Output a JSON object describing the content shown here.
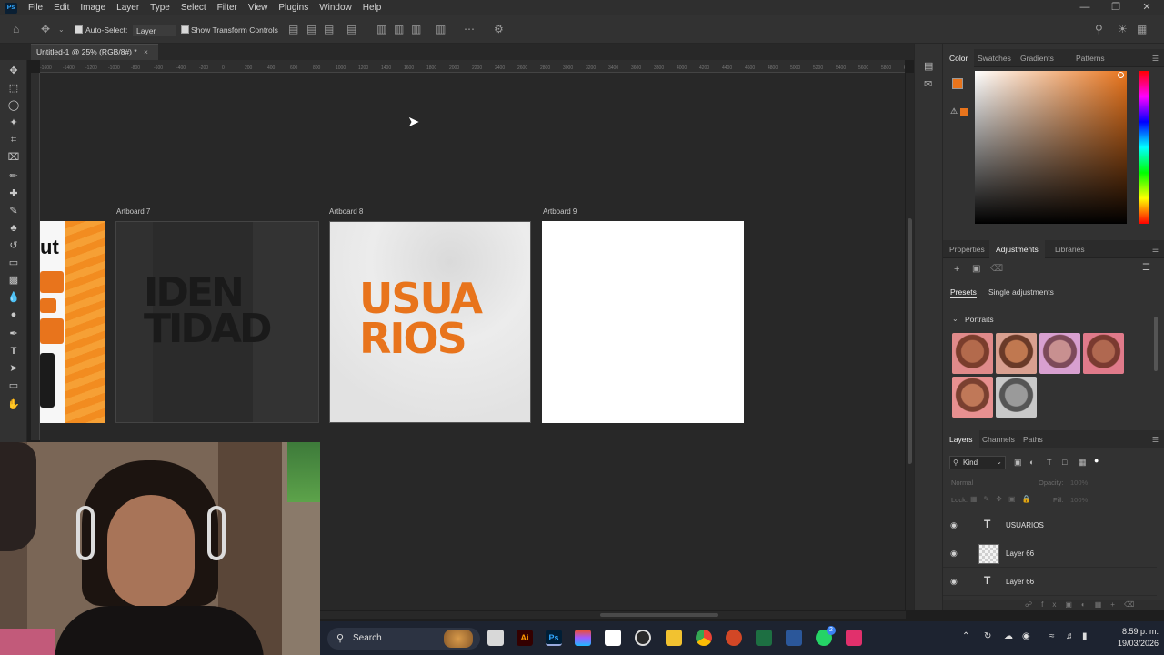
{
  "app": {
    "menu": [
      "File",
      "Edit",
      "Image",
      "Layer",
      "Type",
      "Select",
      "Filter",
      "View",
      "Plugins",
      "Window",
      "Help"
    ],
    "logo_text": "Ps"
  },
  "options_bar": {
    "auto_select_label": "Auto-Select:",
    "auto_select_value": "Layer",
    "show_transform_label": "Show Transform Controls"
  },
  "document": {
    "tab_title": "Untitled-1 @ 25% (RGB/8#) *",
    "ruler_ticks": [
      "-1600",
      "-1400",
      "-1200",
      "-1000",
      "-800",
      "-600",
      "-400",
      "-200",
      "0",
      "200",
      "400",
      "600",
      "800",
      "1000",
      "1200",
      "1400",
      "1600",
      "1800",
      "2000",
      "2200",
      "2400",
      "2600",
      "2800",
      "3000",
      "3200",
      "3400",
      "3600",
      "3800",
      "4000",
      "4200",
      "4400",
      "4600",
      "4800",
      "5000",
      "5200",
      "5400",
      "5600",
      "5800",
      "6000"
    ]
  },
  "artboards": [
    {
      "label": "",
      "partial_text": "ut"
    },
    {
      "label": "Artboard 7",
      "text_line1": "IDEN",
      "text_line2": "TIDAD"
    },
    {
      "label": "Artboard 8",
      "text_line1": "USUA",
      "text_line2": "RIOS"
    },
    {
      "label": "Artboard 9"
    }
  ],
  "color_panel": {
    "tabs": [
      "Color",
      "Swatches",
      "Gradients",
      "Patterns"
    ],
    "foreground_color": "#e8741c",
    "hue_color": "#e8741c"
  },
  "adjustments_panel": {
    "tabs": [
      "Properties",
      "Adjustments",
      "Libraries"
    ],
    "subtabs": [
      "Presets",
      "Single adjustments"
    ],
    "group_label": "Portraits"
  },
  "layers_panel": {
    "tabs": [
      "Layers",
      "Channels",
      "Paths"
    ],
    "filter_label": "Kind",
    "blend_mode": "Normal",
    "opacity_label": "Opacity:",
    "opacity_value": "100%",
    "lock_label": "Lock:",
    "fill_label": "Fill:",
    "fill_value": "100%",
    "layers": [
      {
        "name": "USUARIOS",
        "kind": "text"
      },
      {
        "name": "Layer 66",
        "kind": "image"
      },
      {
        "name": "Layer 66",
        "kind": "text"
      }
    ]
  },
  "taskbar": {
    "search_placeholder": "Search",
    "time": "8:59 p. m.",
    "date": "19/03/2026",
    "whatsapp_badge": "2"
  }
}
